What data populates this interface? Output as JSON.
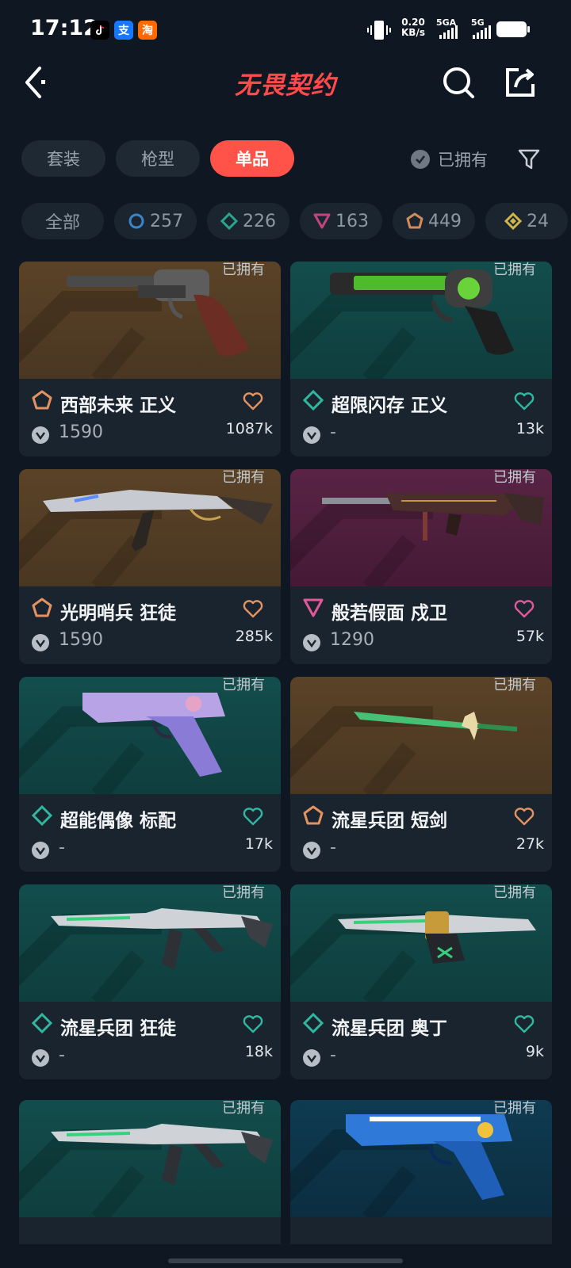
{
  "status_bar": {
    "time": "17:12",
    "app_icons": [
      "tiktok-icon",
      "alipay-icon",
      "taobao-icon"
    ],
    "alipay_glyph": "支",
    "taobao_glyph": "淘",
    "net_speed": "0.20",
    "net_unit": "KB/s",
    "sim1": "5GA",
    "sim2": "5G"
  },
  "header": {
    "title": "无畏契约",
    "title_color": "#ff4a4a"
  },
  "tabs": [
    {
      "label": "套装",
      "active": false
    },
    {
      "label": "枪型",
      "active": false
    },
    {
      "label": "单品",
      "active": true
    }
  ],
  "owned_filter_label": "已拥有",
  "chips": [
    {
      "label": "全部",
      "icon": "all"
    },
    {
      "label": "257",
      "icon": "select-tier-icon",
      "color": "#3b84c7"
    },
    {
      "label": "226",
      "icon": "deluxe-tier-icon",
      "color": "#2aa58d"
    },
    {
      "label": "163",
      "icon": "premium-tier-icon",
      "color": "#c0457f"
    },
    {
      "label": "449",
      "icon": "exclusive-tier-icon",
      "color": "#d48b59"
    },
    {
      "label": "24",
      "icon": "ultra-tier-icon",
      "color": "#d0b54a"
    }
  ],
  "accent_colors": {
    "active_tab": "#ff5249",
    "exclusive": "#e39262",
    "deluxe": "#2fb7a0",
    "premium": "#e05a9b"
  },
  "items": [
    {
      "owned": "已拥有",
      "name": "西部未来 正义",
      "price": "1590",
      "likes": "1087k",
      "tier": "exclusive",
      "bg": "bronze",
      "weapon": "revolver"
    },
    {
      "owned": "已拥有",
      "name": "超限闪存 正义",
      "price": "-",
      "likes": "13k",
      "tier": "deluxe",
      "bg": "green",
      "weapon": "revolver-green"
    },
    {
      "owned": "已拥有",
      "name": "光明哨兵 狂徒",
      "price": "1590",
      "likes": "285k",
      "tier": "exclusive",
      "bg": "bronze",
      "weapon": "rifle-white"
    },
    {
      "owned": "已拥有",
      "name": "般若假面 戍卫",
      "price": "1290",
      "likes": "57k",
      "tier": "premium",
      "bg": "purple",
      "weapon": "rifle-red"
    },
    {
      "owned": "已拥有",
      "name": "超能偶像 标配",
      "price": "-",
      "likes": "17k",
      "tier": "deluxe",
      "bg": "green",
      "weapon": "pistol-purple"
    },
    {
      "owned": "已拥有",
      "name": "流星兵团 短剑",
      "price": "-",
      "likes": "27k",
      "tier": "exclusive",
      "bg": "bronze",
      "weapon": "knife-green"
    },
    {
      "owned": "已拥有",
      "name": "流星兵团 狂徒",
      "price": "-",
      "likes": "18k",
      "tier": "deluxe",
      "bg": "green",
      "weapon": "rifle-green"
    },
    {
      "owned": "已拥有",
      "name": "流星兵团 奥丁",
      "price": "-",
      "likes": "9k",
      "tier": "deluxe",
      "bg": "green",
      "weapon": "odin-green"
    },
    {
      "owned": "已拥有",
      "name": "",
      "price": "",
      "likes": "",
      "tier": "deluxe",
      "bg": "green",
      "weapon": "rifle-green"
    },
    {
      "owned": "已拥有",
      "name": "",
      "price": "",
      "likes": "",
      "tier": "deluxe",
      "bg": "blue",
      "weapon": "pistol-blue"
    }
  ]
}
